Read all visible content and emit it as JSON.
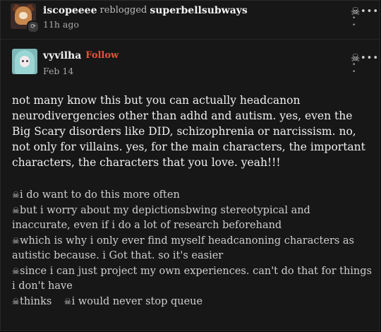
{
  "reblog_header": {
    "username": "iscopeeee",
    "action": "reblogged",
    "source_username": "superbellsubways",
    "timestamp": "11h ago",
    "badge_icon": "reblog-icon"
  },
  "post": {
    "username": "vyvilha",
    "follow_label": "Follow",
    "date": "Feb 14",
    "body": "not many know this but you can actually headcanon neurodivergencies other than adhd and autism. yes, even the Big Scary disorders like DID, schizophrenia or narcissism. no, not only for villains. yes, for the main characters, the important characters, the characters that you love. yeah!!!",
    "tags": [
      "i do want to do this more often",
      "but i worry about my depictionsbwing stereotypical and inaccurate, even if i do a lot of research beforehand",
      "which is why i only ever find myself headcanoning characters as autistic because. i Got that. so it's easier",
      "since i can just project my own experiences. can't do that for things i don't have",
      "thinks",
      "i would never stop queue"
    ]
  },
  "icons": {
    "more_menu": "skull-more-icon",
    "tag_marker": "skull-tag-icon"
  },
  "colors": {
    "background": "#171717",
    "text": "#f0f0f0",
    "follow": "#e8503a"
  }
}
